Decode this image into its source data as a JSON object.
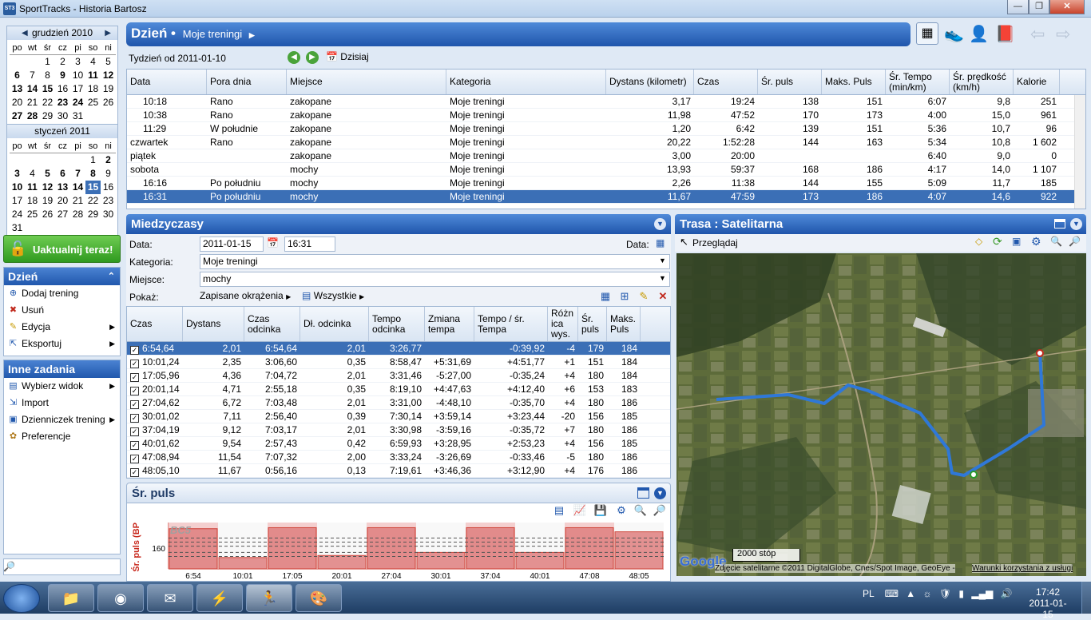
{
  "window": {
    "title": "SportTracks - Historia Bartosz",
    "min": "—",
    "max": "❐",
    "close": "✕"
  },
  "calendar1": {
    "month": "grudzień 2010",
    "dow": [
      "po",
      "wt",
      "śr",
      "cz",
      "pi",
      "so",
      "ni"
    ],
    "days": [
      [
        "",
        "",
        "1",
        "2",
        "3",
        "4",
        "5"
      ],
      [
        "6",
        "7",
        "8",
        "9",
        "10",
        "11",
        "12"
      ],
      [
        "13",
        "14",
        "15",
        "16",
        "17",
        "18",
        "19"
      ],
      [
        "20",
        "21",
        "22",
        "23",
        "24",
        "25",
        "26"
      ],
      [
        "27",
        "28",
        "29",
        "30",
        "31",
        "",
        ""
      ]
    ]
  },
  "calendar2": {
    "month": "styczeń 2011",
    "dow": [
      "po",
      "wt",
      "śr",
      "cz",
      "pi",
      "so",
      "ni"
    ],
    "days": [
      [
        "",
        "",
        "",
        "",
        "",
        "1",
        "2"
      ],
      [
        "3",
        "4",
        "5",
        "6",
        "7",
        "8",
        "9"
      ],
      [
        "10",
        "11",
        "12",
        "13",
        "14",
        "15",
        "16"
      ],
      [
        "17",
        "18",
        "19",
        "20",
        "21",
        "22",
        "23"
      ],
      [
        "24",
        "25",
        "26",
        "27",
        "28",
        "29",
        "30"
      ],
      [
        "31",
        "",
        "",
        "",
        "",
        "",
        ""
      ]
    ]
  },
  "update": {
    "label": "Uaktualnij teraz!"
  },
  "day_tasks": {
    "title": "Dzień",
    "items": [
      {
        "label": "Dodaj trening",
        "icon": "add-icon"
      },
      {
        "label": "Usuń",
        "icon": "delete-icon"
      },
      {
        "label": "Edycja",
        "icon": "edit-icon",
        "arrow": "▶"
      },
      {
        "label": "Eksportuj",
        "icon": "export-icon",
        "arrow": "▶"
      }
    ]
  },
  "other_tasks": {
    "title": "Inne zadania",
    "items": [
      {
        "label": "Wybierz widok",
        "icon": "view-icon",
        "arrow": "▶"
      },
      {
        "label": "Import",
        "icon": "import-icon"
      },
      {
        "label": "Dzienniczek trening",
        "icon": "journal-icon",
        "arrow": "▶"
      },
      {
        "label": "Preferencje",
        "icon": "settings-icon"
      }
    ]
  },
  "header": {
    "title": "Dzień •",
    "subtitle": "Moje treningi",
    "week": "Tydzień od 2011-01-10",
    "today": "Dzisiaj"
  },
  "activities": {
    "columns": [
      "Data",
      "Pora dnia",
      "Miejsce",
      "Kategoria",
      "Dystans (kilometr)",
      "Czas",
      "Śr. puls",
      "Maks. Puls",
      "Śr. Tempo (min/km)",
      "Śr. prędkość (km/h)",
      "Kalorie"
    ],
    "rows": [
      [
        "10:18",
        "Rano",
        "zakopane",
        "Moje treningi",
        "3,17",
        "19:24",
        "138",
        "151",
        "6:07",
        "9,8",
        "251"
      ],
      [
        "10:38",
        "Rano",
        "zakopane",
        "Moje treningi",
        "11,98",
        "47:52",
        "170",
        "173",
        "4:00",
        "15,0",
        "961"
      ],
      [
        "11:29",
        "W południe",
        "zakopane",
        "Moje treningi",
        "1,20",
        "6:42",
        "139",
        "151",
        "5:36",
        "10,7",
        "96"
      ],
      [
        "czwartek",
        "Rano",
        "zakopane",
        "Moje treningi",
        "20,22",
        "1:52:28",
        "144",
        "163",
        "5:34",
        "10,8",
        "1 602"
      ],
      [
        "piątek",
        "",
        "zakopane",
        "Moje treningi",
        "3,00",
        "20:00",
        "",
        "",
        "6:40",
        "9,0",
        "0"
      ],
      [
        "sobota",
        "",
        "mochy",
        "Moje treningi",
        "13,93",
        "59:37",
        "168",
        "186",
        "4:17",
        "14,0",
        "1 107"
      ],
      [
        "16:16",
        "Po południu",
        "mochy",
        "Moje treningi",
        "2,26",
        "11:38",
        "144",
        "155",
        "5:09",
        "11,7",
        "185"
      ],
      [
        "16:31",
        "Po południu",
        "mochy",
        "Moje treningi",
        "11,67",
        "47:59",
        "173",
        "186",
        "4:07",
        "14,6",
        "922"
      ]
    ],
    "selected": 7
  },
  "splits": {
    "title": "Miedzyczasy",
    "date_label": "Data:",
    "date": "2011-01-15",
    "time": "16:31",
    "date_right": "Data:",
    "category_label": "Kategoria:",
    "category": "Moje treningi",
    "place_label": "Miejsce:",
    "place": "mochy",
    "show_label": "Pokaż:",
    "show_value": "Zapisane okrążenia",
    "filter": "Wszystkie",
    "columns": [
      "Czas",
      "Dystans",
      "Czas odcinka",
      "Dł. odcinka",
      "Tempo odcinka",
      "Zmiana tempa",
      "Tempo / śr. Tempa",
      "Różn ica wys.",
      "Śr. puls",
      "Maks. Puls"
    ],
    "rows": [
      [
        "6:54,64",
        "2,01",
        "6:54,64",
        "2,01",
        "3:26,77",
        "",
        "-0:39,92",
        "-4",
        "179",
        "184"
      ],
      [
        "10:01,24",
        "2,35",
        "3:06,60",
        "0,35",
        "8:58,47",
        "+5:31,69",
        "+4:51,77",
        "+1",
        "151",
        "184"
      ],
      [
        "17:05,96",
        "4,36",
        "7:04,72",
        "2,01",
        "3:31,46",
        "-5:27,00",
        "-0:35,24",
        "+4",
        "180",
        "184"
      ],
      [
        "20:01,14",
        "4,71",
        "2:55,18",
        "0,35",
        "8:19,10",
        "+4:47,63",
        "+4:12,40",
        "+6",
        "153",
        "183"
      ],
      [
        "27:04,62",
        "6,72",
        "7:03,48",
        "2,01",
        "3:31,00",
        "-4:48,10",
        "-0:35,70",
        "+4",
        "180",
        "186"
      ],
      [
        "30:01,02",
        "7,11",
        "2:56,40",
        "0,39",
        "7:30,14",
        "+3:59,14",
        "+3:23,44",
        "-20",
        "156",
        "185"
      ],
      [
        "37:04,19",
        "9,12",
        "7:03,17",
        "2,01",
        "3:30,98",
        "-3:59,16",
        "-0:35,72",
        "+7",
        "180",
        "186"
      ],
      [
        "40:01,62",
        "9,54",
        "2:57,43",
        "0,42",
        "6:59,93",
        "+3:28,95",
        "+2:53,23",
        "+4",
        "156",
        "185"
      ],
      [
        "47:08,94",
        "11,54",
        "7:07,32",
        "2,00",
        "3:33,24",
        "-3:26,69",
        "-0:33,46",
        "-5",
        "180",
        "186"
      ],
      [
        "48:05,10",
        "11,67",
        "0:56,16",
        "0,13",
        "7:19,61",
        "+3:46,36",
        "+3:12,90",
        "+4",
        "176",
        "186"
      ]
    ],
    "selected": 0
  },
  "pulse_chart": {
    "title": "Śr. puls",
    "ylabel": "Śr. puls (BP",
    "watermark": "BC5"
  },
  "chart_data": {
    "type": "bar",
    "categories": [
      "6:54",
      "10:01",
      "17:05",
      "20:01",
      "27:04",
      "30:01",
      "37:04",
      "40:01",
      "47:08",
      "48:05"
    ],
    "values": [
      179,
      151,
      180,
      153,
      180,
      156,
      180,
      156,
      180,
      176
    ],
    "ylabel": "Śr. puls (BP",
    "yticks": [
      160
    ],
    "ylim": [
      140,
      185
    ]
  },
  "map": {
    "title": "Trasa : Satelitarna",
    "mode": "Przeglądaj",
    "scale": "2000 stóp",
    "attribution": "Zdjęcie satelitarne ©2011 DigitalGlobe, Cnes/Spot Image, GeoEye -",
    "terms": "Warunki korzystania z usługi",
    "logo": "Google"
  },
  "taskbar": {
    "lang": "PL",
    "time": "17:42",
    "date": "2011-01-15"
  }
}
